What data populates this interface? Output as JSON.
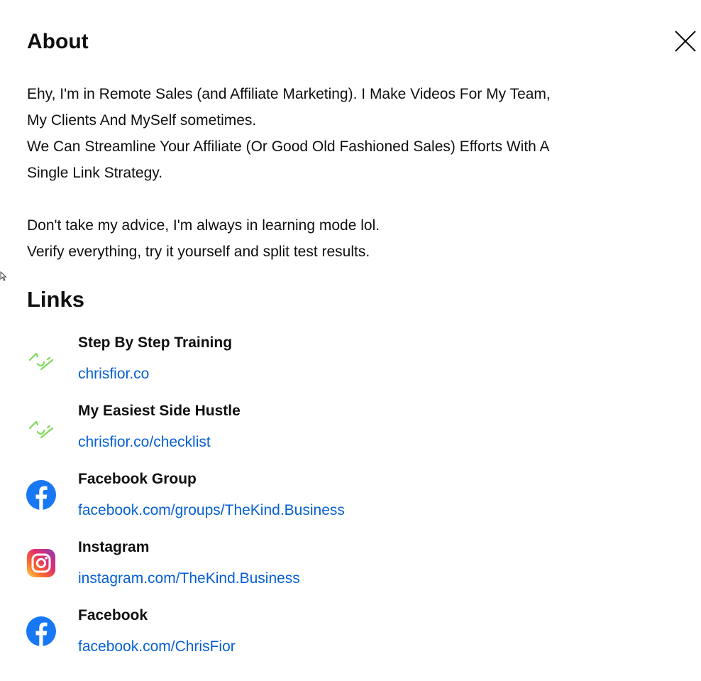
{
  "about": {
    "title": "About",
    "description_lines": [
      "Ehy, I'm in Remote Sales (and Affiliate Marketing). I Make Videos For My Team,",
      "My Clients And MySelf sometimes.",
      "We Can Streamline Your Affiliate (Or Good Old Fashioned Sales) Efforts With A",
      "Single Link Strategy.",
      "",
      "Don't take my advice, I'm always in learning mode lol.",
      "Verify everything, try it yourself and split test results."
    ]
  },
  "links": {
    "title": "Links",
    "items": [
      {
        "icon": "link-site-icon",
        "title": "Step By Step Training",
        "url": "chrisfior.co"
      },
      {
        "icon": "link-site-icon",
        "title": "My Easiest Side Hustle",
        "url": "chrisfior.co/checklist"
      },
      {
        "icon": "facebook-icon",
        "title": "Facebook Group",
        "url": "facebook.com/groups/TheKind.Business"
      },
      {
        "icon": "instagram-icon",
        "title": "Instagram",
        "url": "instagram.com/TheKind.Business"
      },
      {
        "icon": "facebook-icon",
        "title": "Facebook",
        "url": "facebook.com/ChrisFior"
      }
    ]
  },
  "colors": {
    "link": "#065fd4",
    "text": "#0f0f0f",
    "facebook": "#1877f2",
    "site_icon": "#7ed957"
  },
  "icons": {
    "close": "close-icon",
    "cursor": "mouse-cursor-icon"
  }
}
